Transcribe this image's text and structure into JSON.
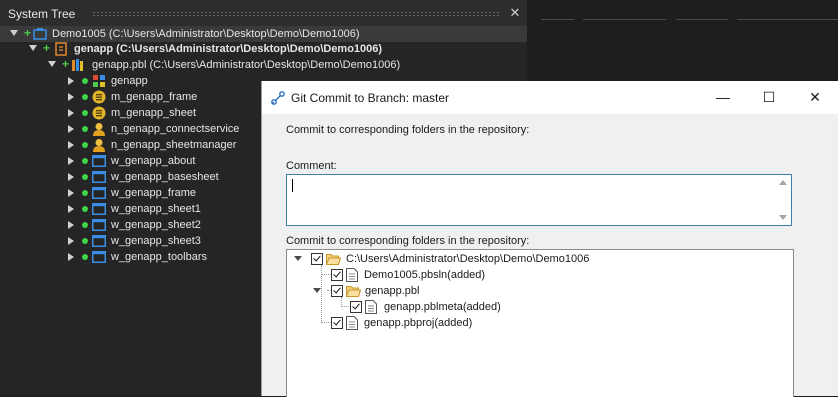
{
  "system_tree": {
    "title": "System Tree",
    "close_glyph": "✕",
    "rows": [
      {
        "label": "Demo1005 (C:\\Users\\Administrator\\Desktop\\Demo\\Demo1006)",
        "icon": "workspace-icon"
      },
      {
        "label": "genapp (C:\\Users\\Administrator\\Desktop\\Demo\\Demo1006)",
        "icon": "target-icon"
      },
      {
        "label": "genapp.pbl (C:\\Users\\Administrator\\Desktop\\Demo\\Demo1006)",
        "icon": "library-icon"
      },
      {
        "label": "genapp",
        "icon": "application-icon"
      },
      {
        "label": "m_genapp_frame",
        "icon": "menu-icon"
      },
      {
        "label": "m_genapp_sheet",
        "icon": "menu-icon"
      },
      {
        "label": "n_genapp_connectservice",
        "icon": "user-object-icon"
      },
      {
        "label": "n_genapp_sheetmanager",
        "icon": "user-object-icon"
      },
      {
        "label": "w_genapp_about",
        "icon": "window-icon"
      },
      {
        "label": "w_genapp_basesheet",
        "icon": "window-icon"
      },
      {
        "label": "w_genapp_frame",
        "icon": "window-icon"
      },
      {
        "label": "w_genapp_sheet1",
        "icon": "window-icon"
      },
      {
        "label": "w_genapp_sheet2",
        "icon": "window-icon"
      },
      {
        "label": "w_genapp_sheet3",
        "icon": "window-icon"
      },
      {
        "label": "w_genapp_toolbars",
        "icon": "window-icon"
      }
    ]
  },
  "dialog": {
    "title": "Git Commit to Branch: master",
    "minimize_glyph": "—",
    "maximize_glyph": "☐",
    "close_glyph": "✕",
    "intro_text": "Commit to corresponding folders in the repository:",
    "comment_label": "Comment:",
    "comment_value": "",
    "folders_label": "Commit to corresponding folders in the repository:",
    "repo_tree": [
      {
        "label": "C:\\Users\\Administrator\\Desktop\\Demo\\Demo1006",
        "icon": "folder-open-icon",
        "checked": true
      },
      {
        "label": "Demo1005.pbsln(added)",
        "icon": "file-icon",
        "checked": true
      },
      {
        "label": "genapp.pbl",
        "icon": "folder-open-icon",
        "checked": true
      },
      {
        "label": "genapp.pblmeta(added)",
        "icon": "file-icon",
        "checked": true
      },
      {
        "label": "genapp.pbproj(added)",
        "icon": "file-icon",
        "checked": true
      }
    ]
  },
  "colors": {
    "ide_background": "#1e1e1e",
    "panel_background": "#252526",
    "status_green": "#3fd34a",
    "dialog_background": "#f0f0f0",
    "focus_border": "#3c7fb1"
  }
}
